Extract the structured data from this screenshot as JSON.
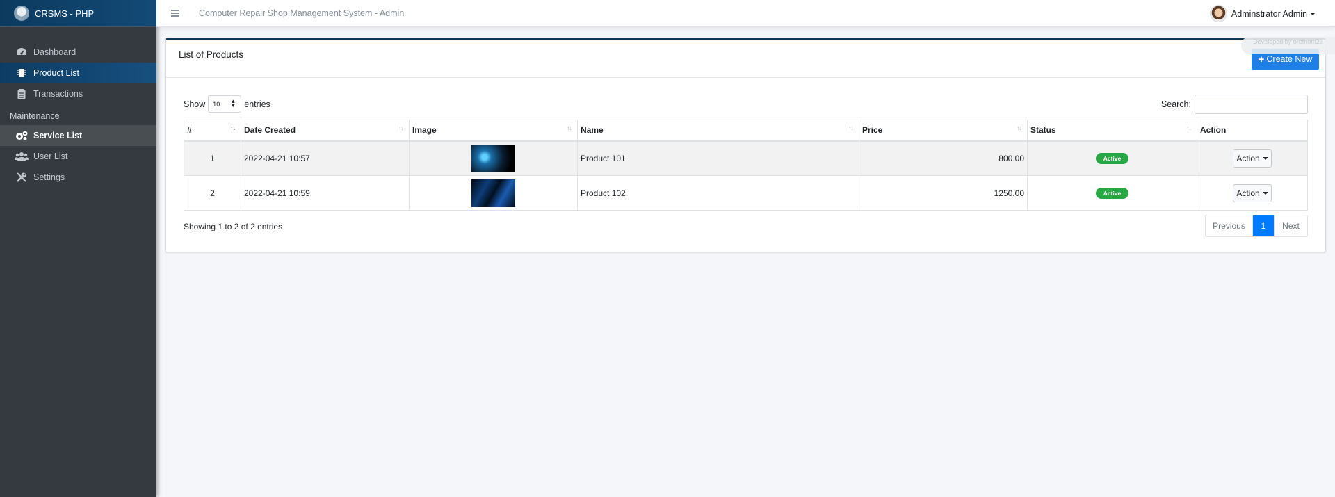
{
  "brand": {
    "name": "CRSMS - PHP"
  },
  "sidebar": {
    "items": [
      {
        "label": "Dashboard",
        "icon": "dashboard-icon"
      },
      {
        "label": "Product List",
        "icon": "product-icon"
      },
      {
        "label": "Transactions",
        "icon": "transactions-icon"
      }
    ],
    "section_header": "Maintenance",
    "maintenance_items": [
      {
        "label": "Service List",
        "icon": "cogs-icon"
      },
      {
        "label": "User List",
        "icon": "users-icon"
      },
      {
        "label": "Settings",
        "icon": "tools-icon"
      }
    ]
  },
  "topbar": {
    "title": "Computer Repair Shop Management System - Admin",
    "user_name": "Adminstrator Admin"
  },
  "card": {
    "title": "List of Products",
    "create_label": "Create New",
    "dev_badge": "Developed by oretnom23"
  },
  "table_controls": {
    "show_label": "Show",
    "entries_value": "10",
    "entries_label": "entries",
    "search_label": "Search:"
  },
  "table": {
    "columns": [
      "#",
      "Date Created",
      "Image",
      "Name",
      "Price",
      "Status",
      "Action"
    ],
    "rows": [
      {
        "num": "1",
        "date": "2022-04-21 10:57",
        "name": "Product 101",
        "price": "800.00",
        "status": "Active",
        "action": "Action"
      },
      {
        "num": "2",
        "date": "2022-04-21 10:59",
        "name": "Product 102",
        "price": "1250.00",
        "status": "Active",
        "action": "Action"
      }
    ]
  },
  "footer": {
    "info": "Showing 1 to 2 of 2 entries",
    "prev": "Previous",
    "page": "1",
    "next": "Next"
  },
  "colors": {
    "accent": "#007bff",
    "brand": "#0c3a5f",
    "status_active": "#28a745",
    "sidebar_bg": "#343a40"
  }
}
